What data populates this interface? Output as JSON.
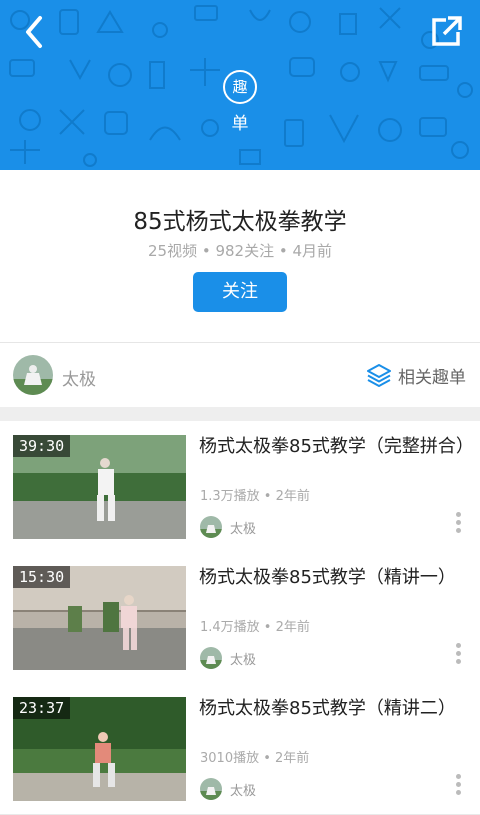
{
  "header": {
    "badge_char": "趣",
    "badge_label": "单",
    "back_icon": "chevron-left-icon",
    "share_icon": "external-link-icon",
    "bg_color": "#1a8fe8"
  },
  "playlist": {
    "title": "85式杨式太极拳教学",
    "meta": "25视频 • 982关注 • 4月前",
    "follow_label": "关注"
  },
  "author": {
    "name": "太极",
    "related_label": "相关趣单"
  },
  "videos": [
    {
      "duration": "39:30",
      "title": "杨式太极拳85式教学（完整拼合）",
      "meta": "1.3万播放 • 2年前",
      "author": "太极"
    },
    {
      "duration": "15:30",
      "title": "杨式太极拳85式教学（精讲一）",
      "meta": "1.4万播放 • 2年前",
      "author": "太极"
    },
    {
      "duration": "23:37",
      "title": "杨式太极拳85式教学（精讲二）",
      "meta": "3010播放 • 2年前",
      "author": "太极"
    }
  ]
}
